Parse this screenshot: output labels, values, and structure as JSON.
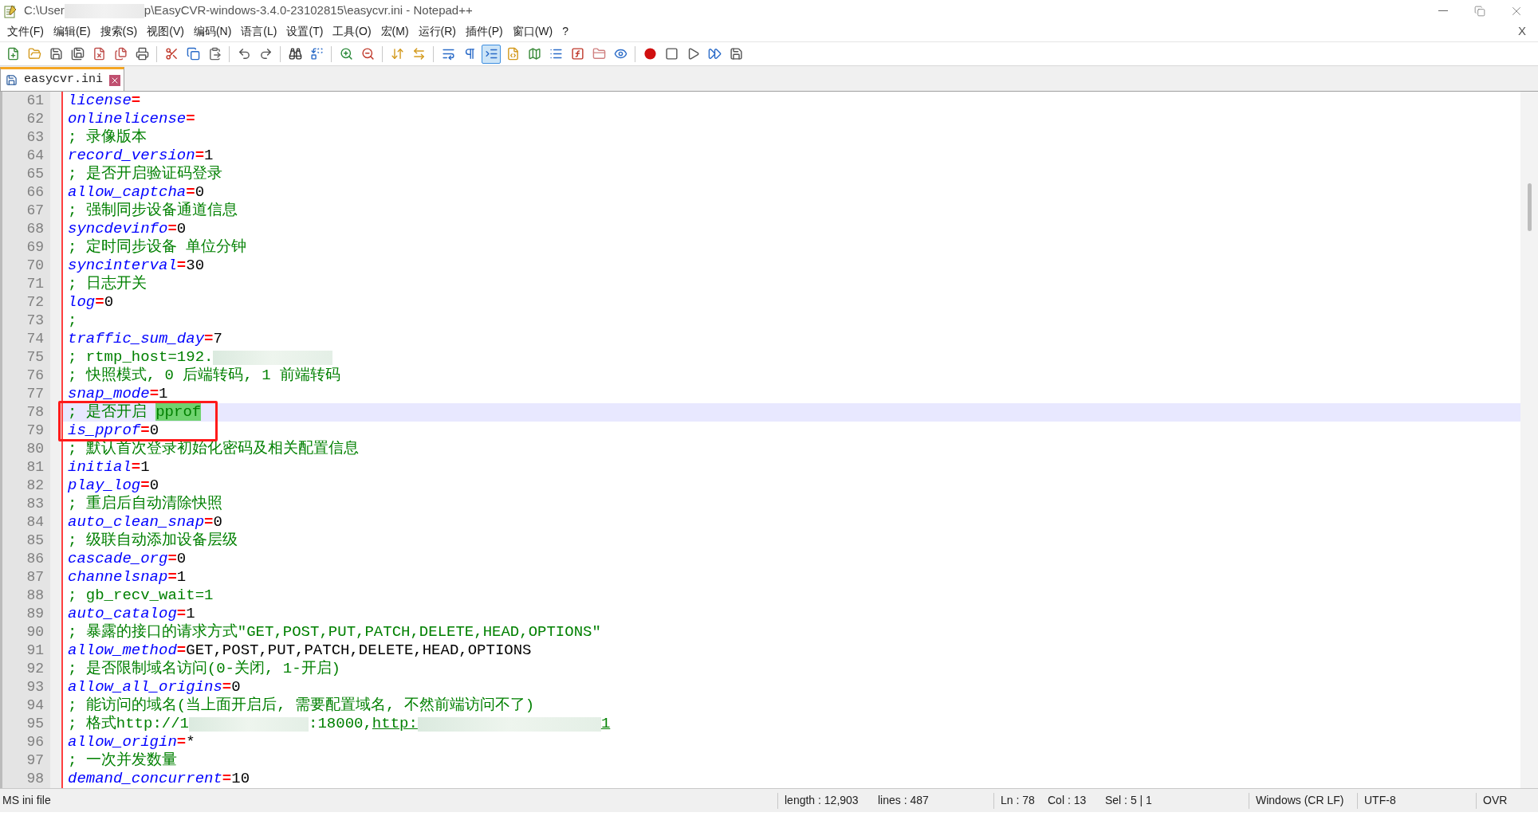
{
  "window": {
    "title_parts": [
      {
        "kind": "text",
        "text": "C:\\User"
      },
      {
        "kind": "redacted"
      },
      {
        "kind": "text",
        "text": "p\\EasyCVR-windows-3.4.0-23102815\\easycvr.ini - Notepad++"
      }
    ]
  },
  "menu": [
    "文件(F)",
    "编辑(E)",
    "搜索(S)",
    "视图(V)",
    "编码(N)",
    "语言(L)",
    "设置(T)",
    "工具(O)",
    "宏(M)",
    "运行(R)",
    "插件(P)",
    "窗口(W)",
    "?"
  ],
  "menu_close": "X",
  "toolbar": [
    {
      "kind": "new",
      "pressed": false
    },
    {
      "kind": "open",
      "pressed": false
    },
    {
      "kind": "save",
      "pressed": false
    },
    {
      "kind": "save_all",
      "pressed": false
    },
    {
      "kind": "close",
      "pressed": false
    },
    {
      "kind": "close_all",
      "pressed": false
    },
    {
      "kind": "print",
      "pressed": false
    },
    {
      "kind": "separator"
    },
    {
      "kind": "cut",
      "pressed": false
    },
    {
      "kind": "copy",
      "pressed": false
    },
    {
      "kind": "paste",
      "pressed": false
    },
    {
      "kind": "separator"
    },
    {
      "kind": "undo",
      "pressed": false
    },
    {
      "kind": "redo",
      "pressed": false
    },
    {
      "kind": "separator"
    },
    {
      "kind": "find",
      "pressed": false
    },
    {
      "kind": "replace",
      "pressed": false
    },
    {
      "kind": "separator"
    },
    {
      "kind": "zoom_in",
      "pressed": false
    },
    {
      "kind": "zoom_out",
      "pressed": false
    },
    {
      "kind": "separator"
    },
    {
      "kind": "sync_v",
      "pressed": false
    },
    {
      "kind": "sync_h",
      "pressed": false
    },
    {
      "kind": "separator"
    },
    {
      "kind": "wrap",
      "pressed": false
    },
    {
      "kind": "all_chars",
      "pressed": false
    },
    {
      "kind": "indent_guide",
      "pressed": true
    },
    {
      "kind": "udl",
      "pressed": false
    },
    {
      "kind": "doc_map",
      "pressed": false
    },
    {
      "kind": "doc_list",
      "pressed": false
    },
    {
      "kind": "function_list",
      "pressed": false
    },
    {
      "kind": "folder",
      "pressed": false
    },
    {
      "kind": "monitor",
      "pressed": false
    },
    {
      "kind": "separator"
    },
    {
      "kind": "record",
      "pressed": false
    },
    {
      "kind": "stop",
      "pressed": false
    },
    {
      "kind": "play",
      "pressed": false
    },
    {
      "kind": "play_multi",
      "pressed": false
    },
    {
      "kind": "save_macro",
      "pressed": false
    }
  ],
  "tabs": [
    {
      "label": "easycvr.ini",
      "selected": true
    }
  ],
  "lines": [
    {
      "number": "61",
      "current": false,
      "boxed": false,
      "parts": [
        {
          "kind": "key",
          "text": "license"
        },
        {
          "kind": "operator",
          "text": "="
        }
      ]
    },
    {
      "number": "62",
      "current": false,
      "boxed": false,
      "parts": [
        {
          "kind": "key",
          "text": "onlinelicense"
        },
        {
          "kind": "operator",
          "text": "="
        }
      ]
    },
    {
      "number": "63",
      "current": false,
      "boxed": false,
      "parts": [
        {
          "kind": "comment",
          "text": "; 录像版本"
        }
      ]
    },
    {
      "number": "64",
      "current": false,
      "boxed": false,
      "parts": [
        {
          "kind": "key",
          "text": "record_version"
        },
        {
          "kind": "operator",
          "text": "="
        },
        {
          "kind": "value",
          "text": "1"
        }
      ]
    },
    {
      "number": "65",
      "current": false,
      "boxed": false,
      "parts": [
        {
          "kind": "comment",
          "text": "; 是否开启验证码登录"
        }
      ]
    },
    {
      "number": "66",
      "current": false,
      "boxed": false,
      "parts": [
        {
          "kind": "key",
          "text": "allow_captcha"
        },
        {
          "kind": "operator",
          "text": "="
        },
        {
          "kind": "value",
          "text": "0"
        }
      ]
    },
    {
      "number": "67",
      "current": false,
      "boxed": false,
      "parts": [
        {
          "kind": "comment",
          "text": "; 强制同步设备通道信息"
        }
      ]
    },
    {
      "number": "68",
      "current": false,
      "boxed": false,
      "parts": [
        {
          "kind": "key",
          "text": "syncdevinfo"
        },
        {
          "kind": "operator",
          "text": "="
        },
        {
          "kind": "value",
          "text": "0"
        }
      ]
    },
    {
      "number": "69",
      "current": false,
      "boxed": false,
      "parts": [
        {
          "kind": "comment",
          "text": "; 定时同步设备 单位分钟"
        }
      ]
    },
    {
      "number": "70",
      "current": false,
      "boxed": false,
      "parts": [
        {
          "kind": "key",
          "text": "syncinterval"
        },
        {
          "kind": "operator",
          "text": "="
        },
        {
          "kind": "value",
          "text": "30"
        }
      ]
    },
    {
      "number": "71",
      "current": false,
      "boxed": false,
      "parts": [
        {
          "kind": "comment",
          "text": "; 日志开关"
        }
      ]
    },
    {
      "number": "72",
      "current": false,
      "boxed": false,
      "parts": [
        {
          "kind": "key",
          "text": "log"
        },
        {
          "kind": "operator",
          "text": "="
        },
        {
          "kind": "value",
          "text": "0"
        }
      ]
    },
    {
      "number": "73",
      "current": false,
      "boxed": false,
      "parts": [
        {
          "kind": "comment",
          "text": ";"
        }
      ]
    },
    {
      "number": "74",
      "current": false,
      "boxed": false,
      "parts": [
        {
          "kind": "key",
          "text": "traffic_sum_day"
        },
        {
          "kind": "operator",
          "text": "="
        },
        {
          "kind": "value",
          "text": "7"
        }
      ]
    },
    {
      "number": "75",
      "current": false,
      "boxed": false,
      "parts": [
        {
          "kind": "comment",
          "text": "; rtmp_host=192."
        },
        {
          "kind": "redacted"
        }
      ]
    },
    {
      "number": "76",
      "current": false,
      "boxed": false,
      "parts": [
        {
          "kind": "comment",
          "text": "; 快照模式, 0 后端转码, 1 前端转码"
        }
      ]
    },
    {
      "number": "77",
      "current": false,
      "boxed": false,
      "parts": [
        {
          "kind": "key",
          "text": "snap_mode"
        },
        {
          "kind": "operator",
          "text": "="
        },
        {
          "kind": "value",
          "text": "1"
        }
      ]
    },
    {
      "number": "78",
      "current": true,
      "boxed": true,
      "parts": [
        {
          "kind": "comment",
          "text": "; 是否开启 "
        },
        {
          "kind": "match",
          "text": "pprof"
        }
      ]
    },
    {
      "number": "79",
      "current": false,
      "boxed": true,
      "parts": [
        {
          "kind": "key",
          "text": "is_pprof"
        },
        {
          "kind": "operator",
          "text": "="
        },
        {
          "kind": "value",
          "text": "0"
        }
      ]
    },
    {
      "number": "80",
      "current": false,
      "boxed": false,
      "parts": [
        {
          "kind": "comment",
          "text": "; 默认首次登录初始化密码及相关配置信息"
        }
      ]
    },
    {
      "number": "81",
      "current": false,
      "boxed": false,
      "parts": [
        {
          "kind": "key",
          "text": "initial"
        },
        {
          "kind": "operator",
          "text": "="
        },
        {
          "kind": "value",
          "text": "1"
        }
      ]
    },
    {
      "number": "82",
      "current": false,
      "boxed": false,
      "parts": [
        {
          "kind": "key",
          "text": "play_log"
        },
        {
          "kind": "operator",
          "text": "="
        },
        {
          "kind": "value",
          "text": "0"
        }
      ]
    },
    {
      "number": "83",
      "current": false,
      "boxed": false,
      "parts": [
        {
          "kind": "comment",
          "text": "; 重启后自动清除快照"
        }
      ]
    },
    {
      "number": "84",
      "current": false,
      "boxed": false,
      "parts": [
        {
          "kind": "key",
          "text": "auto_clean_snap"
        },
        {
          "kind": "operator",
          "text": "="
        },
        {
          "kind": "value",
          "text": "0"
        }
      ]
    },
    {
      "number": "85",
      "current": false,
      "boxed": false,
      "parts": [
        {
          "kind": "comment",
          "text": "; 级联自动添加设备层级"
        }
      ]
    },
    {
      "number": "86",
      "current": false,
      "boxed": false,
      "parts": [
        {
          "kind": "key",
          "text": "cascade_org"
        },
        {
          "kind": "operator",
          "text": "="
        },
        {
          "kind": "value",
          "text": "0"
        }
      ]
    },
    {
      "number": "87",
      "current": false,
      "boxed": false,
      "parts": [
        {
          "kind": "key",
          "text": "channelsnap"
        },
        {
          "kind": "operator",
          "text": "="
        },
        {
          "kind": "value",
          "text": "1"
        }
      ]
    },
    {
      "number": "88",
      "current": false,
      "boxed": false,
      "parts": [
        {
          "kind": "comment",
          "text": "; gb_recv_wait=1"
        }
      ]
    },
    {
      "number": "89",
      "current": false,
      "boxed": false,
      "parts": [
        {
          "kind": "key",
          "text": "auto_catalog"
        },
        {
          "kind": "operator",
          "text": "="
        },
        {
          "kind": "value",
          "text": "1"
        }
      ]
    },
    {
      "number": "90",
      "current": false,
      "boxed": false,
      "parts": [
        {
          "kind": "comment",
          "text": "; 暴露的接口的请求方式\"GET,POST,PUT,PATCH,DELETE,HEAD,OPTIONS\""
        }
      ]
    },
    {
      "number": "91",
      "current": false,
      "boxed": false,
      "parts": [
        {
          "kind": "key",
          "text": "allow_method"
        },
        {
          "kind": "operator",
          "text": "="
        },
        {
          "kind": "value",
          "text": "GET,POST,PUT,PATCH,DELETE,HEAD,OPTIONS"
        }
      ]
    },
    {
      "number": "92",
      "current": false,
      "boxed": false,
      "parts": [
        {
          "kind": "comment",
          "text": "; 是否限制域名访问(0-关闭, 1-开启)"
        }
      ]
    },
    {
      "number": "93",
      "current": false,
      "boxed": false,
      "parts": [
        {
          "kind": "key",
          "text": "allow_all_origins"
        },
        {
          "kind": "operator",
          "text": "="
        },
        {
          "kind": "value",
          "text": "0"
        }
      ]
    },
    {
      "number": "94",
      "current": false,
      "boxed": false,
      "parts": [
        {
          "kind": "comment",
          "text": "; 能访问的域名(当上面开启后, 需要配置域名, 不然前端访问不了)"
        }
      ]
    },
    {
      "number": "95",
      "current": false,
      "boxed": false,
      "parts": [
        {
          "kind": "comment",
          "text": "; 格式http://1"
        },
        {
          "kind": "redacted"
        },
        {
          "kind": "comment",
          "text": ":18000,"
        },
        {
          "kind": "link",
          "text": "http:"
        },
        {
          "kind": "redacted"
        },
        {
          "kind": "link",
          "text": "1"
        }
      ]
    },
    {
      "number": "96",
      "current": false,
      "boxed": false,
      "parts": [
        {
          "kind": "key",
          "text": "allow_origin"
        },
        {
          "kind": "operator",
          "text": "="
        },
        {
          "kind": "value",
          "text": "*"
        }
      ]
    },
    {
      "number": "97",
      "current": false,
      "boxed": false,
      "parts": [
        {
          "kind": "comment",
          "text": "; 一次并发数量"
        }
      ]
    },
    {
      "number": "98",
      "current": false,
      "boxed": false,
      "parts": [
        {
          "kind": "key",
          "text": "demand_concurrent"
        },
        {
          "kind": "operator",
          "text": "="
        },
        {
          "kind": "value",
          "text": "10"
        }
      ]
    }
  ],
  "status_bar": {
    "file_type": "MS ini file",
    "length": "length : 12,903",
    "lines": "lines : 487",
    "ln": "Ln : 78",
    "col": "Col : 13",
    "sel": "Sel : 5 | 1",
    "eol": "Windows (CR LF)",
    "encoding": "UTF-8",
    "mode": "OVR"
  }
}
